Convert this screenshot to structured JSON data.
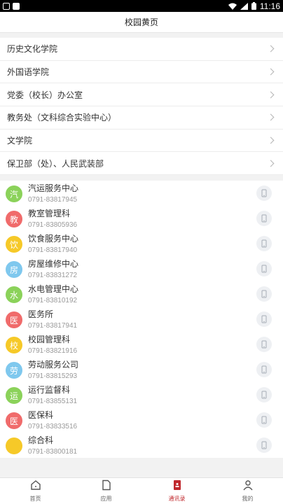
{
  "status_bar": {
    "time": "11:16"
  },
  "header": {
    "title": "校园黄页"
  },
  "sections": [
    {
      "label": "历史文化学院"
    },
    {
      "label": "外国语学院"
    },
    {
      "label": "党委（校长）办公室"
    },
    {
      "label": "教务处（文科综合实验中心）"
    },
    {
      "label": "文学院"
    },
    {
      "label": "保卫部（处）、人民武装部"
    }
  ],
  "contacts": [
    {
      "avatar_char": "汽",
      "color": "#8bd25a",
      "name": "汽运服务中心",
      "phone": "0791-83817945"
    },
    {
      "avatar_char": "教",
      "color": "#f06b6b",
      "name": "教室管理科",
      "phone": "0791-83805936"
    },
    {
      "avatar_char": "饮",
      "color": "#f6c928",
      "name": "饮食服务中心",
      "phone": "0791-83817940"
    },
    {
      "avatar_char": "房",
      "color": "#7fc8ee",
      "name": "房屋维修中心",
      "phone": "0791-83831272"
    },
    {
      "avatar_char": "水",
      "color": "#8bd25a",
      "name": "水电管理中心",
      "phone": "0791-83810192"
    },
    {
      "avatar_char": "医",
      "color": "#f06b6b",
      "name": "医务所",
      "phone": "0791-83817941"
    },
    {
      "avatar_char": "校",
      "color": "#f6c928",
      "name": "校园管理科",
      "phone": "0791-83821916"
    },
    {
      "avatar_char": "劳",
      "color": "#7fc8ee",
      "name": "劳动服务公司",
      "phone": "0791-83815293"
    },
    {
      "avatar_char": "运",
      "color": "#8bd25a",
      "name": "运行监督科",
      "phone": "0791-83855131"
    },
    {
      "avatar_char": "医",
      "color": "#f06b6b",
      "name": "医保科",
      "phone": "0791-83833516"
    },
    {
      "avatar_char": "",
      "color": "#f6c928",
      "name": "综合科",
      "phone": "0791-83800181"
    }
  ],
  "tabbar": [
    {
      "label": "首页",
      "icon": "home-icon"
    },
    {
      "label": "应用",
      "icon": "document-icon"
    },
    {
      "label": "通讯录",
      "icon": "contacts-book-icon",
      "active": true
    },
    {
      "label": "我的",
      "icon": "person-icon"
    }
  ],
  "colors": {
    "accent": "#c0282d"
  }
}
